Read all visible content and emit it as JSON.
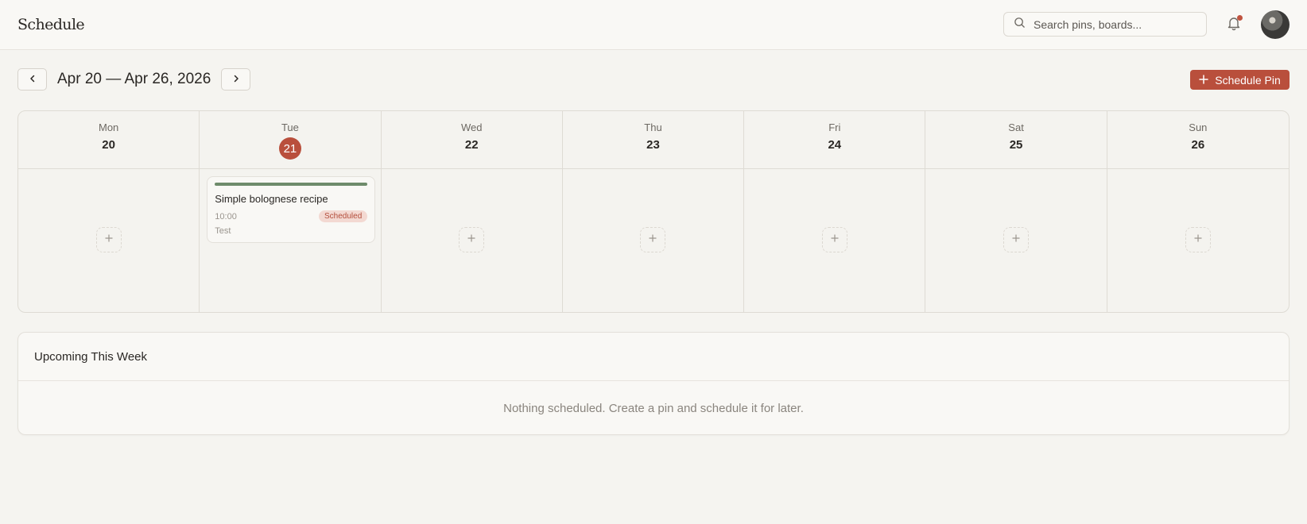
{
  "header": {
    "title": "Schedule",
    "search_placeholder": "Search pins, boards...",
    "notification_dot_color": "#c0533f"
  },
  "week_nav": {
    "range_label": "Apr 20 — Apr 26, 2026",
    "prev_icon": "chevron-left-icon",
    "next_icon": "chevron-right-icon"
  },
  "actions": {
    "schedule_pin_label": "Schedule Pin",
    "accent_color": "#b94f3c"
  },
  "days": [
    {
      "name": "Mon",
      "num": "20"
    },
    {
      "name": "Tue",
      "num": "21",
      "today": true
    },
    {
      "name": "Wed",
      "num": "22"
    },
    {
      "name": "Thu",
      "num": "23"
    },
    {
      "name": "Fri",
      "num": "24"
    },
    {
      "name": "Sat",
      "num": "25"
    },
    {
      "name": "Sun",
      "num": "26"
    }
  ],
  "scheduled_pin": {
    "title": "Simple bolognese recipe",
    "time": "10:00",
    "status": "Scheduled",
    "board": "Test",
    "bar_color": "#6e8b6b"
  },
  "upcoming": {
    "title": "Upcoming This Week",
    "empty_message": "Nothing scheduled. Create a pin and schedule it for later."
  }
}
